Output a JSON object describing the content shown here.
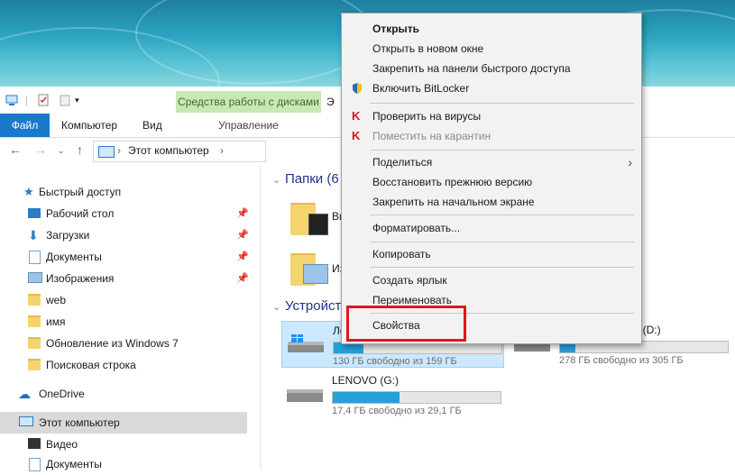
{
  "ribbon": {
    "contextual_tab": "Средства работы с дисками",
    "contextual_manage": "Управление",
    "tabs": [
      "Файл",
      "Компьютер",
      "Вид"
    ],
    "partial_tab": "Э"
  },
  "address": {
    "path": "Этот компьютер",
    "separator": "›"
  },
  "sidebar": {
    "quick_access": "Быстрый доступ",
    "items": [
      "Рабочий стол",
      "Загрузки",
      "Документы",
      "Изображения",
      "web",
      "имя",
      "Обновление из Windows 7",
      "Поисковая строка"
    ],
    "onedrive": "OneDrive",
    "this_pc": "Этот компьютер",
    "pc_items": [
      "Видео",
      "Документы"
    ]
  },
  "content": {
    "folders_title": "Папки (6",
    "folder_partial_1": "Ви",
    "folder_partial_2": "Из",
    "devices_title": "Устройст",
    "drives": [
      {
        "name": "Ло",
        "free": "130 ГБ свободно из 159 ГБ",
        "used_fraction": 0.18
      },
      {
        "name": "к (D:)",
        "free": "278 ГБ свободно из 305 ГБ",
        "used_fraction": 0.09
      },
      {
        "name": "LENOVO (G:)",
        "free": "17,4 ГБ свободно из 29,1 ГБ",
        "used_fraction": 0.4
      }
    ]
  },
  "context_menu": {
    "items": [
      {
        "label": "Открыть",
        "style": "bold"
      },
      {
        "label": "Открыть в новом окне"
      },
      {
        "label": "Закрепить на панели быстрого доступа"
      },
      {
        "label": "Включить BitLocker",
        "icon": "shield-icon"
      },
      {
        "label": "Проверить на вирусы",
        "icon": "kaspersky-icon"
      },
      {
        "label": "Поместить на карантин",
        "icon": "kaspersky-icon",
        "disabled": true
      },
      {
        "label": "Поделиться",
        "submenu": true
      },
      {
        "label": "Восстановить прежнюю версию"
      },
      {
        "label": "Закрепить на начальном экране"
      },
      {
        "label": "Форматировать..."
      },
      {
        "label": "Копировать"
      },
      {
        "label": "Создать ярлык"
      },
      {
        "label": "Переименовать"
      },
      {
        "label": "Свойства"
      }
    ]
  },
  "colors": {
    "file_tab": "#1979ca",
    "context_tab": "#c7e8b5",
    "highlight": "#e4141b",
    "selection": "#cce8ff"
  }
}
